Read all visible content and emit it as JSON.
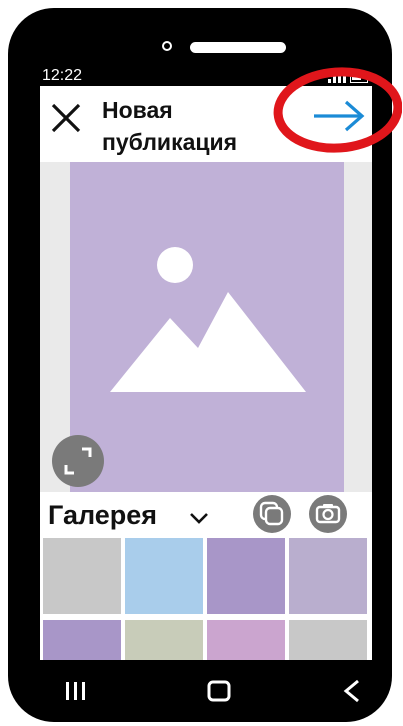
{
  "status_bar": {
    "time": "12:22",
    "icons": [
      "signal-icon",
      "battery-icon"
    ]
  },
  "header": {
    "title": "Новая публикация",
    "close_icon": "close-icon",
    "next_icon": "arrow-right-icon",
    "next_color": "#1b8bd6"
  },
  "preview": {
    "placeholder_icon": "image-placeholder-icon",
    "expand_icon": "expand-icon",
    "color": "#c0b1d7"
  },
  "gallery": {
    "label": "Галерея",
    "dropdown_icon": "chevron-down-icon",
    "multi_select_icon": "multi-select-icon",
    "camera_icon": "camera-icon",
    "thumbnails": [
      {
        "color": "#c8c8c8"
      },
      {
        "color": "#a9cdeb"
      },
      {
        "color": "#a896c8"
      },
      {
        "color": "#b9aece"
      },
      {
        "color": "#a896c8"
      },
      {
        "color": "#c8ccb9"
      },
      {
        "color": "#cba5cf"
      },
      {
        "color": "#c8c8c8"
      }
    ]
  },
  "navbar": {
    "icons": [
      "recent-apps-icon",
      "home-icon",
      "back-icon"
    ]
  },
  "annotation": {
    "color": "#e0161b"
  }
}
